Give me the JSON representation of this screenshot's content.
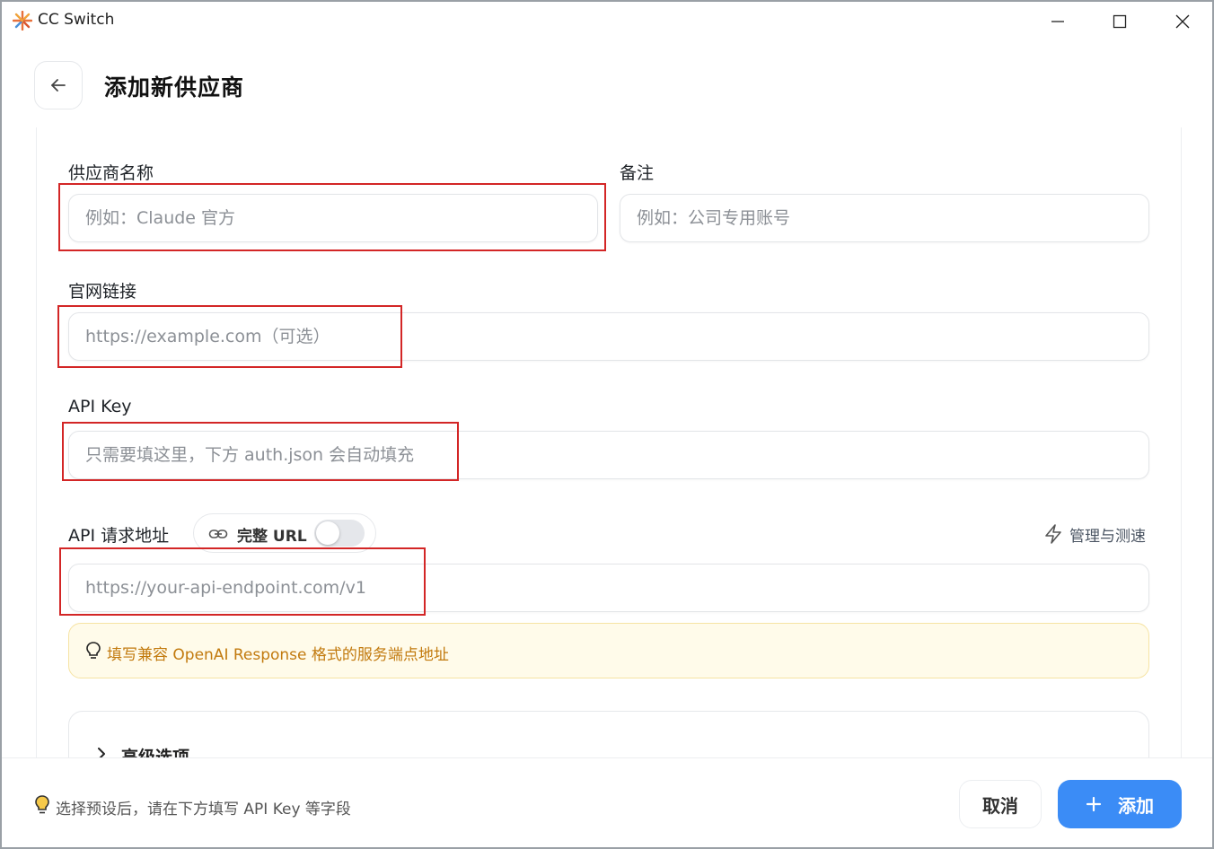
{
  "window": {
    "title": "CC Switch"
  },
  "header": {
    "title": "添加新供应商"
  },
  "form": {
    "name": {
      "label": "供应商名称",
      "placeholder": "例如：Claude 官方",
      "value": ""
    },
    "notes": {
      "label": "备注",
      "placeholder": "例如：公司专用账号",
      "value": ""
    },
    "website": {
      "label": "官网链接",
      "placeholder": "https://example.com（可选）",
      "value": ""
    },
    "api_key": {
      "label": "API Key",
      "placeholder": "只需要填这里，下方 auth.json 会自动填充",
      "value": ""
    },
    "endpoint": {
      "label": "API 请求地址",
      "full_url_toggle_label": "完整 URL",
      "full_url_enabled": false,
      "manage_label": "管理与测速",
      "placeholder": "https://your-api-endpoint.com/v1",
      "value": "",
      "hint": "填写兼容 OpenAI Response 格式的服务端点地址"
    },
    "advanced": {
      "label": "高级选项"
    }
  },
  "footer": {
    "hint": "选择预设后，请在下方填写 API Key 等字段",
    "cancel_label": "取消",
    "add_label": "添加"
  },
  "colors": {
    "accent": "#3b8cf6",
    "highlight_box": "#d32626",
    "hint_text": "#c27a0e",
    "hint_background": "#fffbea"
  },
  "icons": {
    "app_logo": "starburst-logo-icon",
    "back": "arrow-left-icon",
    "link": "link-icon",
    "manage": "lightning-icon",
    "hint": "lightbulb-icon",
    "advanced": "chevron-right-icon",
    "add": "plus-icon"
  }
}
